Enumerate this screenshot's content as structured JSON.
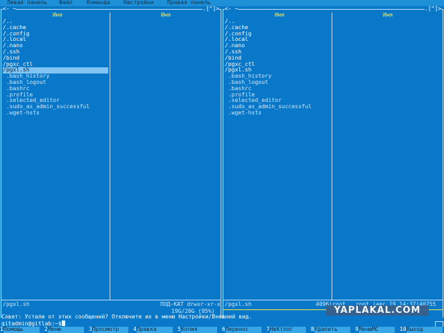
{
  "menu": [
    "Левая панель",
    "Файл",
    "Команда",
    "Настройки",
    "Правая панель"
  ],
  "left_panel": {
    "corner_left": "<- ~",
    "corner_right": ".[^]>",
    "col1_header": "Имя",
    "col2_header": "Имя",
    "files": [
      {
        "name": "/..",
        "kind": "dir"
      },
      {
        "name": "/.cache",
        "kind": "dir"
      },
      {
        "name": "/.config",
        "kind": "dir"
      },
      {
        "name": "/.local",
        "kind": "dir"
      },
      {
        "name": "/.nano",
        "kind": "dir"
      },
      {
        "name": "/.ssh",
        "kind": "dir"
      },
      {
        "name": "/bind",
        "kind": "dir"
      },
      {
        "name": "/pgxc_ctl",
        "kind": "dir"
      },
      {
        "name": "/pgxl.sh",
        "kind": "sel"
      },
      {
        "name": " .bash_history",
        "kind": "file"
      },
      {
        "name": " .bash_logout",
        "kind": "file"
      },
      {
        "name": " .bashrc",
        "kind": "file"
      },
      {
        "name": " .profile",
        "kind": "file"
      },
      {
        "name": " .selected_editor",
        "kind": "file"
      },
      {
        "name": " .sudo_as_admin_successful",
        "kind": "file"
      },
      {
        "name": " .wget-hsts",
        "kind": "file"
      }
    ],
    "status_left": "/pgxl.sh",
    "status_right": "ПОД-КАТ drwxr-xr-x",
    "free_space": "19G/20G (95%)"
  },
  "right_panel": {
    "corner_left": "<- ~",
    "corner_right": ".[^]>",
    "col1_header": "Имя",
    "col2_header": "Имя",
    "files": [
      {
        "name": "/..",
        "kind": "dir"
      },
      {
        "name": "/.cache",
        "kind": "dir"
      },
      {
        "name": "/.config",
        "kind": "dir"
      },
      {
        "name": "/.local",
        "kind": "dir"
      },
      {
        "name": "/.nano",
        "kind": "dir"
      },
      {
        "name": "/.ssh",
        "kind": "dir"
      },
      {
        "name": "/bind",
        "kind": "dir"
      },
      {
        "name": "/pgxc_ctl",
        "kind": "dir"
      },
      {
        "name": "/pgxl.sh",
        "kind": "dir"
      },
      {
        "name": " .bash_history",
        "kind": "file"
      },
      {
        "name": " .bash_logout",
        "kind": "file"
      },
      {
        "name": " .bashrc",
        "kind": "file"
      },
      {
        "name": " .profile",
        "kind": "file"
      },
      {
        "name": " .selected_editor",
        "kind": "file"
      },
      {
        "name": " .sudo_as_admin_successful",
        "kind": "file"
      },
      {
        "name": " .wget-hsts",
        "kind": "file"
      }
    ],
    "status_left": "/pgxl.sh",
    "status_right": "4096|root   root |авг 19 14:37|40755"
  },
  "hint": "Совет: Устали от этих сообщений? Отключите их в меню Настройки/Внешний вид.",
  "prompt": "gitadmin@gitlab:~$",
  "fkeys": [
    {
      "num": "1",
      "label": "Помощь"
    },
    {
      "num": "2",
      "label": "Меню"
    },
    {
      "num": "3",
      "label": "Просмотр"
    },
    {
      "num": "4",
      "label": "Правка"
    },
    {
      "num": "5",
      "label": "Копия"
    },
    {
      "num": "6",
      "label": "Перенос"
    },
    {
      "num": "7",
      "label": "НвКтлог"
    },
    {
      "num": "8",
      "label": "Удалить"
    },
    {
      "num": "9",
      "label": "МенюMC"
    },
    {
      "num": "10",
      "label": "Выход"
    }
  ],
  "watermark": "YAPLAKAL.COM"
}
